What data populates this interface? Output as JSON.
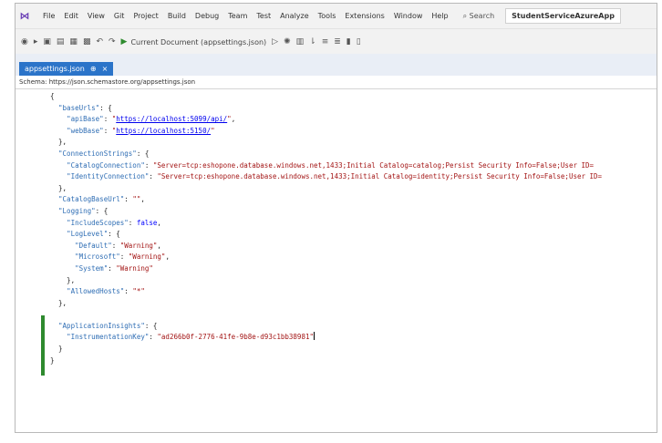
{
  "menubar": {
    "items": [
      "File",
      "Edit",
      "View",
      "Git",
      "Project",
      "Build",
      "Debug",
      "Team",
      "Test",
      "Analyze",
      "Tools",
      "Extensions",
      "Window",
      "Help"
    ],
    "search": "Search",
    "app_title": "StudentServiceAzureApp"
  },
  "toolbar": {
    "run_target": "Current Document (appsettings.json)"
  },
  "tab": {
    "label": "appsettings.json",
    "pin": "⊕",
    "close": "×"
  },
  "schema": {
    "text": "Schema: https://json.schemastore.org/appsettings.json"
  },
  "editor": {
    "lines": [
      [
        {
          "t": "{",
          "c": "p"
        }
      ],
      [
        {
          "t": "  ",
          "c": "p"
        },
        {
          "t": "\"baseUrls\"",
          "c": "k"
        },
        {
          "t": ": {",
          "c": "p"
        }
      ],
      [
        {
          "t": "    ",
          "c": "p"
        },
        {
          "t": "\"apiBase\"",
          "c": "k"
        },
        {
          "t": ": ",
          "c": "p"
        },
        {
          "t": "\"",
          "c": "s"
        },
        {
          "t": "https://localhost:5099/api/",
          "c": "u"
        },
        {
          "t": "\"",
          "c": "s"
        },
        {
          "t": ",",
          "c": "p"
        }
      ],
      [
        {
          "t": "    ",
          "c": "p"
        },
        {
          "t": "\"webBase\"",
          "c": "k"
        },
        {
          "t": ": ",
          "c": "p"
        },
        {
          "t": "\"",
          "c": "s"
        },
        {
          "t": "https://localhost:5150/",
          "c": "u"
        },
        {
          "t": "\"",
          "c": "s"
        }
      ],
      [
        {
          "t": "  },",
          "c": "p"
        }
      ],
      [
        {
          "t": "  ",
          "c": "p"
        },
        {
          "t": "\"ConnectionStrings\"",
          "c": "k"
        },
        {
          "t": ": {",
          "c": "p"
        }
      ],
      [
        {
          "t": "    ",
          "c": "p"
        },
        {
          "t": "\"CatalogConnection\"",
          "c": "k"
        },
        {
          "t": ": ",
          "c": "p"
        },
        {
          "t": "\"Server=tcp:eshopone.database.windows.net,1433;Initial Catalog=catalog;Persist Security Info=False;User ID=",
          "c": "s"
        }
      ],
      [
        {
          "t": "    ",
          "c": "p"
        },
        {
          "t": "\"IdentityConnection\"",
          "c": "k"
        },
        {
          "t": ": ",
          "c": "p"
        },
        {
          "t": "\"Server=tcp:eshopone.database.windows.net,1433;Initial Catalog=identity;Persist Security Info=False;User ID=",
          "c": "s"
        }
      ],
      [
        {
          "t": "  },",
          "c": "p"
        }
      ],
      [
        {
          "t": "  ",
          "c": "p"
        },
        {
          "t": "\"CatalogBaseUrl\"",
          "c": "k"
        },
        {
          "t": ": ",
          "c": "p"
        },
        {
          "t": "\"\"",
          "c": "s"
        },
        {
          "t": ",",
          "c": "p"
        }
      ],
      [
        {
          "t": "  ",
          "c": "p"
        },
        {
          "t": "\"Logging\"",
          "c": "k"
        },
        {
          "t": ": {",
          "c": "p"
        }
      ],
      [
        {
          "t": "    ",
          "c": "p"
        },
        {
          "t": "\"IncludeScopes\"",
          "c": "k"
        },
        {
          "t": ": ",
          "c": "p"
        },
        {
          "t": "false",
          "c": "kw"
        },
        {
          "t": ",",
          "c": "p"
        }
      ],
      [
        {
          "t": "    ",
          "c": "p"
        },
        {
          "t": "\"LogLevel\"",
          "c": "k"
        },
        {
          "t": ": {",
          "c": "p"
        }
      ],
      [
        {
          "t": "      ",
          "c": "p"
        },
        {
          "t": "\"Default\"",
          "c": "k"
        },
        {
          "t": ": ",
          "c": "p"
        },
        {
          "t": "\"Warning\"",
          "c": "s"
        },
        {
          "t": ",",
          "c": "p"
        }
      ],
      [
        {
          "t": "      ",
          "c": "p"
        },
        {
          "t": "\"Microsoft\"",
          "c": "k"
        },
        {
          "t": ": ",
          "c": "p"
        },
        {
          "t": "\"Warning\"",
          "c": "s"
        },
        {
          "t": ",",
          "c": "p"
        }
      ],
      [
        {
          "t": "      ",
          "c": "p"
        },
        {
          "t": "\"System\"",
          "c": "k"
        },
        {
          "t": ": ",
          "c": "p"
        },
        {
          "t": "\"Warning\"",
          "c": "s"
        }
      ],
      [
        {
          "t": "    },",
          "c": "p"
        }
      ],
      [
        {
          "t": "    ",
          "c": "p"
        },
        {
          "t": "\"AllowedHosts\"",
          "c": "k"
        },
        {
          "t": ": ",
          "c": "p"
        },
        {
          "t": "\"*\"",
          "c": "s"
        }
      ],
      [
        {
          "t": "  },",
          "c": "p"
        }
      ],
      [
        {
          "t": "",
          "c": "p"
        }
      ],
      [
        {
          "t": "  ",
          "c": "p"
        },
        {
          "t": "\"ApplicationInsights\"",
          "c": "k"
        },
        {
          "t": ": {",
          "c": "p"
        }
      ],
      [
        {
          "t": "    ",
          "c": "p"
        },
        {
          "t": "\"InstrumentationKey\"",
          "c": "k"
        },
        {
          "t": ": ",
          "c": "p"
        },
        {
          "t": "\"ad266b0f-2776-41fe-9b8e-d93c1bb38981\"",
          "c": "s"
        },
        {
          "t": "|",
          "c": "caret"
        }
      ],
      [
        {
          "t": "  }",
          "c": "p"
        }
      ],
      [
        {
          "t": "}",
          "c": "p"
        }
      ]
    ]
  }
}
